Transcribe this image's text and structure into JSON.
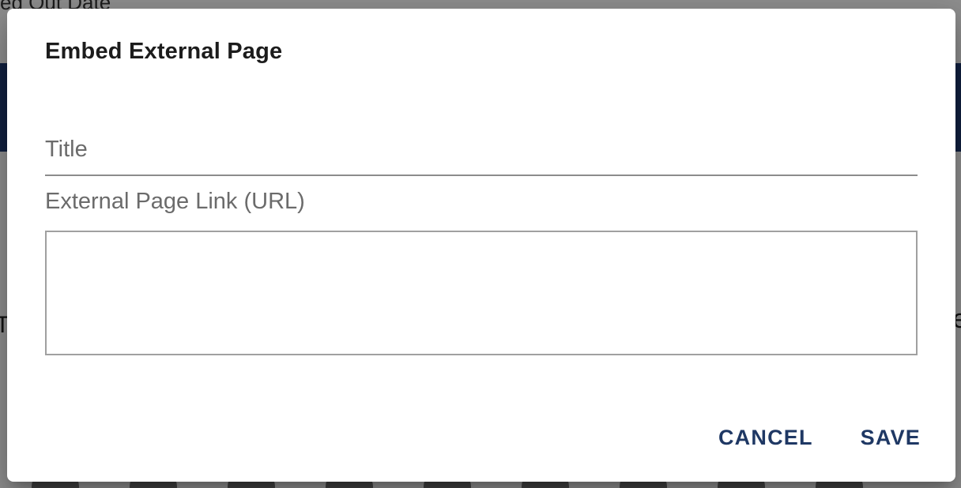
{
  "background": {
    "header_fragment": "ed Out Date",
    "left_edge_letter": "T",
    "right_edge_letter": "Re"
  },
  "dialog": {
    "title": "Embed External Page",
    "title_field": {
      "placeholder": "Title",
      "value": ""
    },
    "url_field": {
      "label": "External Page Link (URL)",
      "value": ""
    },
    "actions": {
      "cancel_label": "CANCEL",
      "save_label": "SAVE"
    }
  },
  "colors": {
    "accent": "#1f3864",
    "banner": "#1f3a6e",
    "label_gray": "#6b6b6b"
  }
}
